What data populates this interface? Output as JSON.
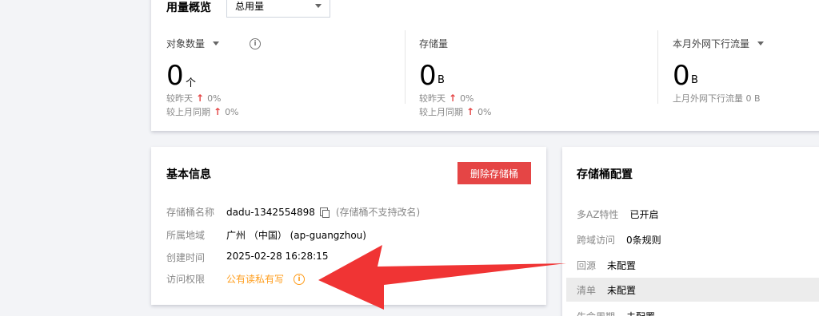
{
  "usage": {
    "title": "用量概览",
    "select_value": "总用量",
    "metrics": [
      {
        "label": "对象数量",
        "value": "0",
        "unit": "个",
        "rows": [
          {
            "label": "较昨天",
            "value": "0%"
          },
          {
            "label": "较上月同期",
            "value": "0%"
          }
        ]
      },
      {
        "label": "存储量",
        "value": "0",
        "unit": "B",
        "rows": [
          {
            "label": "较昨天",
            "value": "0%"
          },
          {
            "label": "较上月同期",
            "value": "0%"
          }
        ]
      },
      {
        "label": "本月外网下行流量",
        "value": "0",
        "unit": "B",
        "extra": "上月外网下行流量 0 B"
      }
    ],
    "up_arrow": "↑"
  },
  "basic": {
    "title": "基本信息",
    "delete_label": "删除存储桶",
    "name_label": "存储桶名称",
    "name_value": "dadu-1342554898",
    "name_note": "(存储桶不支持改名)",
    "region_label": "所属地域",
    "region_value": "广州 （中国） (ap-guangzhou)",
    "created_label": "创建时间",
    "created_value": "2025-02-28 16:28:15",
    "access_label": "访问权限",
    "access_value": "公有读私有写"
  },
  "config": {
    "title": "存储桶配置",
    "rows": [
      {
        "k": "多AZ特性",
        "v": "已开启"
      },
      {
        "k": "跨域访问",
        "v": "0条规则"
      },
      {
        "k": "回源",
        "v": "未配置"
      },
      {
        "k": "清单",
        "v": "未配置"
      },
      {
        "k": "生命周期",
        "v": "未配置"
      }
    ]
  },
  "colors": {
    "accent": "#e54545",
    "warn": "#ff9c19",
    "arrow": "#f03434"
  }
}
